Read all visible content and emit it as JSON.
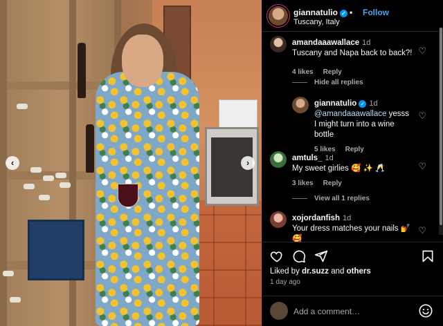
{
  "post": {
    "username": "giannatulio",
    "follow_label": "Follow",
    "separator": "•",
    "location": "Tuscany, Italy"
  },
  "comments": [
    {
      "username": "amandaaawallace",
      "time": "1d",
      "text": "Tuscany and Napa back to back?!",
      "likes": "4 likes",
      "reply_label": "Reply",
      "thread_label": "Hide all replies"
    },
    {
      "username": "giannatulio",
      "time": "1d",
      "mention": "@amandaaawallace",
      "text": " yesss I might turn into a wine bottle",
      "likes": "5 likes",
      "reply_label": "Reply"
    },
    {
      "username": "amtuls_",
      "time": "1d",
      "text": "My sweet girlies 🥰 ✨ 🥂",
      "likes": "3 likes",
      "reply_label": "Reply",
      "thread_label": "View all 1 replies"
    },
    {
      "username": "xojordanfish",
      "time": "1d",
      "text": "Your dress matches your nails 💅",
      "extra": "🥰"
    }
  ],
  "engagement": {
    "liked_by_prefix": "Liked by ",
    "liked_by_user": "dr.suzz",
    "liked_by_middle": " and ",
    "liked_by_others": "others",
    "time_ago": "1 day ago"
  },
  "add_comment": {
    "placeholder": "Add a comment…"
  },
  "icons": {
    "like": "heart-icon",
    "comment": "comment-icon",
    "share": "send-icon",
    "save": "bookmark-icon",
    "emoji": "emoji-icon",
    "prev": "chevron-left-icon",
    "next": "chevron-right-icon"
  },
  "colors": {
    "background": "#000000",
    "link_blue": "#4aa3f0",
    "verified_blue": "#0095f6",
    "muted": "#a8a8a8"
  }
}
